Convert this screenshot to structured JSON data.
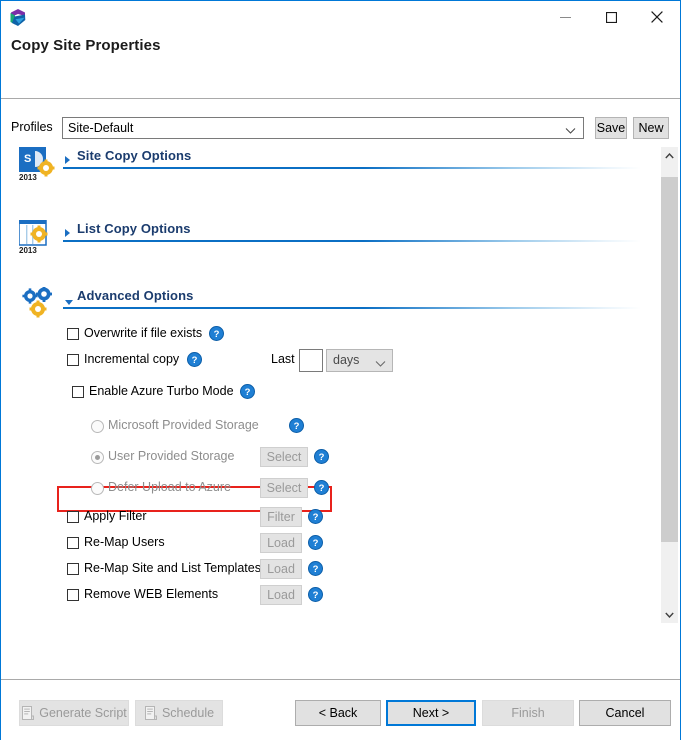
{
  "window": {
    "title": "Copy Site Properties",
    "logo_icon": "app-cube-logo",
    "controls": [
      {
        "name": "minimize-button",
        "icon": "minimize-icon"
      },
      {
        "name": "maximize-button",
        "icon": "maximize-icon"
      },
      {
        "name": "close-button",
        "icon": "close-icon"
      }
    ]
  },
  "profiles": {
    "label": "Profiles",
    "value": "Site-Default",
    "placeholder": "Site-Default",
    "dropdown_icon": "chevron-down-icon",
    "save_label": "Save",
    "new_label": "New"
  },
  "sections": [
    {
      "key": "site_copy",
      "title": "Site Copy Options",
      "icon": "sharepoint-site-gear-icon",
      "icon_year": "2013",
      "expanded": false,
      "caret_icon": "caret-right-icon"
    },
    {
      "key": "list_copy",
      "title": "List Copy Options",
      "icon": "sharepoint-list-gear-icon",
      "icon_year": "2013",
      "expanded": false,
      "caret_icon": "caret-right-icon"
    },
    {
      "key": "advanced",
      "title": "Advanced Options",
      "icon": "gears-icon",
      "expanded": true,
      "caret_icon": "caret-down-icon"
    }
  ],
  "advanced_options": {
    "overwrite": {
      "label": "Overwrite if file exists",
      "checked": false,
      "help_icon": "help-icon"
    },
    "incremental": {
      "label": "Incremental copy",
      "checked": false,
      "help_icon": "help-icon",
      "last_label": "Last",
      "days_value": "",
      "days_placeholder": "",
      "unit_value": "days",
      "unit_dropdown_icon": "chevron-down-icon",
      "highlighted": true,
      "highlight_color": "#e8221c"
    },
    "azure_turbo": {
      "label": "Enable Azure Turbo Mode",
      "checked": false,
      "help_icon": "help-icon"
    },
    "storage_options": [
      {
        "label": "Microsoft Provided Storage",
        "selected": false,
        "disabled": true,
        "button": null,
        "help_icon": "help-icon"
      },
      {
        "label": "User Provided Storage",
        "selected": true,
        "disabled": true,
        "button": "Select",
        "help_icon": "help-icon"
      },
      {
        "label": "Defer Upload to Azure",
        "selected": false,
        "disabled": true,
        "button": "Select",
        "help_icon": "help-icon"
      }
    ],
    "checkbox_options": [
      {
        "label": "Apply Filter",
        "checked": false,
        "button": "Filter",
        "help_icon": "help-icon"
      },
      {
        "label": "Re-Map Users",
        "checked": false,
        "button": "Load",
        "help_icon": "help-icon"
      },
      {
        "label": "Re-Map Site and List Templates",
        "checked": false,
        "button": "Load",
        "help_icon": "help-icon"
      },
      {
        "label": "Remove WEB Elements",
        "checked": false,
        "button": "Load",
        "help_icon": "help-icon"
      }
    ]
  },
  "scrollbar": {
    "up_icon": "chevron-up-icon",
    "down_icon": "chevron-down-icon"
  },
  "footer": {
    "generate_script": {
      "label": "Generate Script",
      "disabled": true,
      "icon": "script-icon"
    },
    "schedule": {
      "label": "Schedule",
      "disabled": true,
      "icon": "script-icon"
    },
    "back": {
      "label": "< Back",
      "disabled": false
    },
    "next": {
      "label": "Next >",
      "disabled": false,
      "focused": true
    },
    "finish": {
      "label": "Finish",
      "disabled": true
    },
    "cancel": {
      "label": "Cancel",
      "disabled": false
    }
  },
  "colors": {
    "accent": "#0078d7",
    "section_title": "#1b3c6e",
    "highlight": "#e8221c",
    "help_blue": "#1f7fd4"
  }
}
